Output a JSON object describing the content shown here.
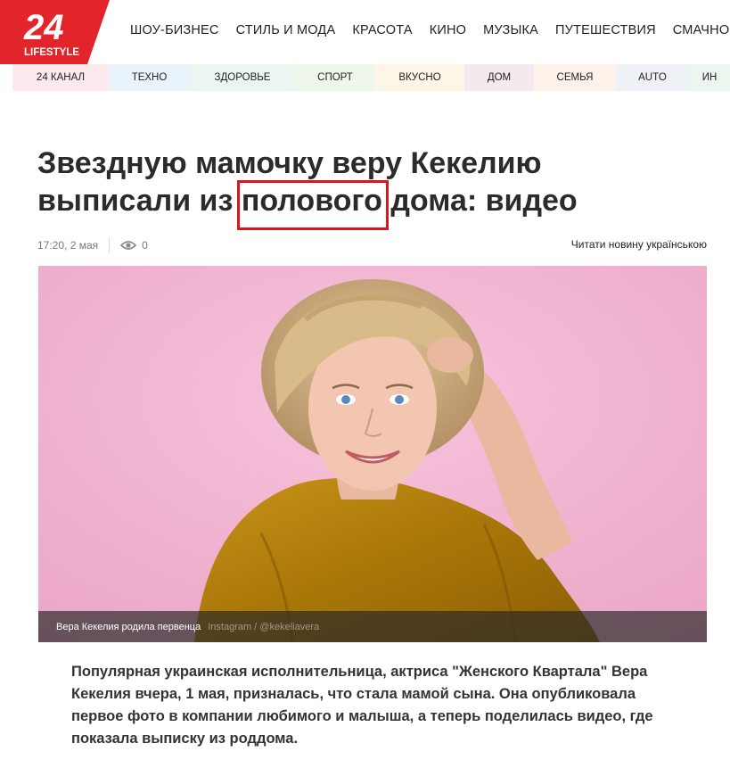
{
  "logo": {
    "number": "24",
    "label": "LIFESTYLE",
    "color": "#e1252b"
  },
  "topnav": [
    "ШОУ-БИЗНЕС",
    "СТИЛЬ И МОДА",
    "КРАСОТА",
    "КИНО",
    "МУЗЫКА",
    "ПУТЕШЕСТВИЯ",
    "СМАЧНО"
  ],
  "subnav": [
    {
      "label": "24 КАНАЛ",
      "bg": "#fce9ee"
    },
    {
      "label": "ТЕХНО",
      "bg": "#e8f3fb"
    },
    {
      "label": "ЗДОРОВЬЕ",
      "bg": "#eaf6ef"
    },
    {
      "label": "СПОРТ",
      "bg": "#eef7ea"
    },
    {
      "label": "ВКУСНО",
      "bg": "#fdf5e6"
    },
    {
      "label": "ДОМ",
      "bg": "#f4e9ef"
    },
    {
      "label": "СЕМЬЯ",
      "bg": "#fdf1ea"
    },
    {
      "label": "AUTO",
      "bg": "#eef2f7"
    },
    {
      "label": "ИН",
      "bg": "#edf6ee"
    }
  ],
  "article": {
    "title_before": "Звездную мамочку веру Кекелию выписали из ",
    "title_highlight": "полового",
    "title_after": " дома: видео",
    "time": "17:20, 2 мая",
    "views": "0",
    "translate_link": "Читати новину українською",
    "photo_caption": "Вера Кекелия родила первенца",
    "photo_credit": "Instagram / @kekeliavera",
    "lead": "Популярная украинская исполнительница, актриса \"Женского Квартала\" Вера Кекелия вчера, 1 мая, призналась, что стала мамой сына. Она опубликовала первое фото в компании любимого и малыша, а теперь поделилась видео, где показала выписку из роддома."
  },
  "colors": {
    "accent": "#e1252b",
    "highlight_box": "#d8161f",
    "photo_bg": "#f0aecd",
    "blouse": "#b8860f"
  }
}
